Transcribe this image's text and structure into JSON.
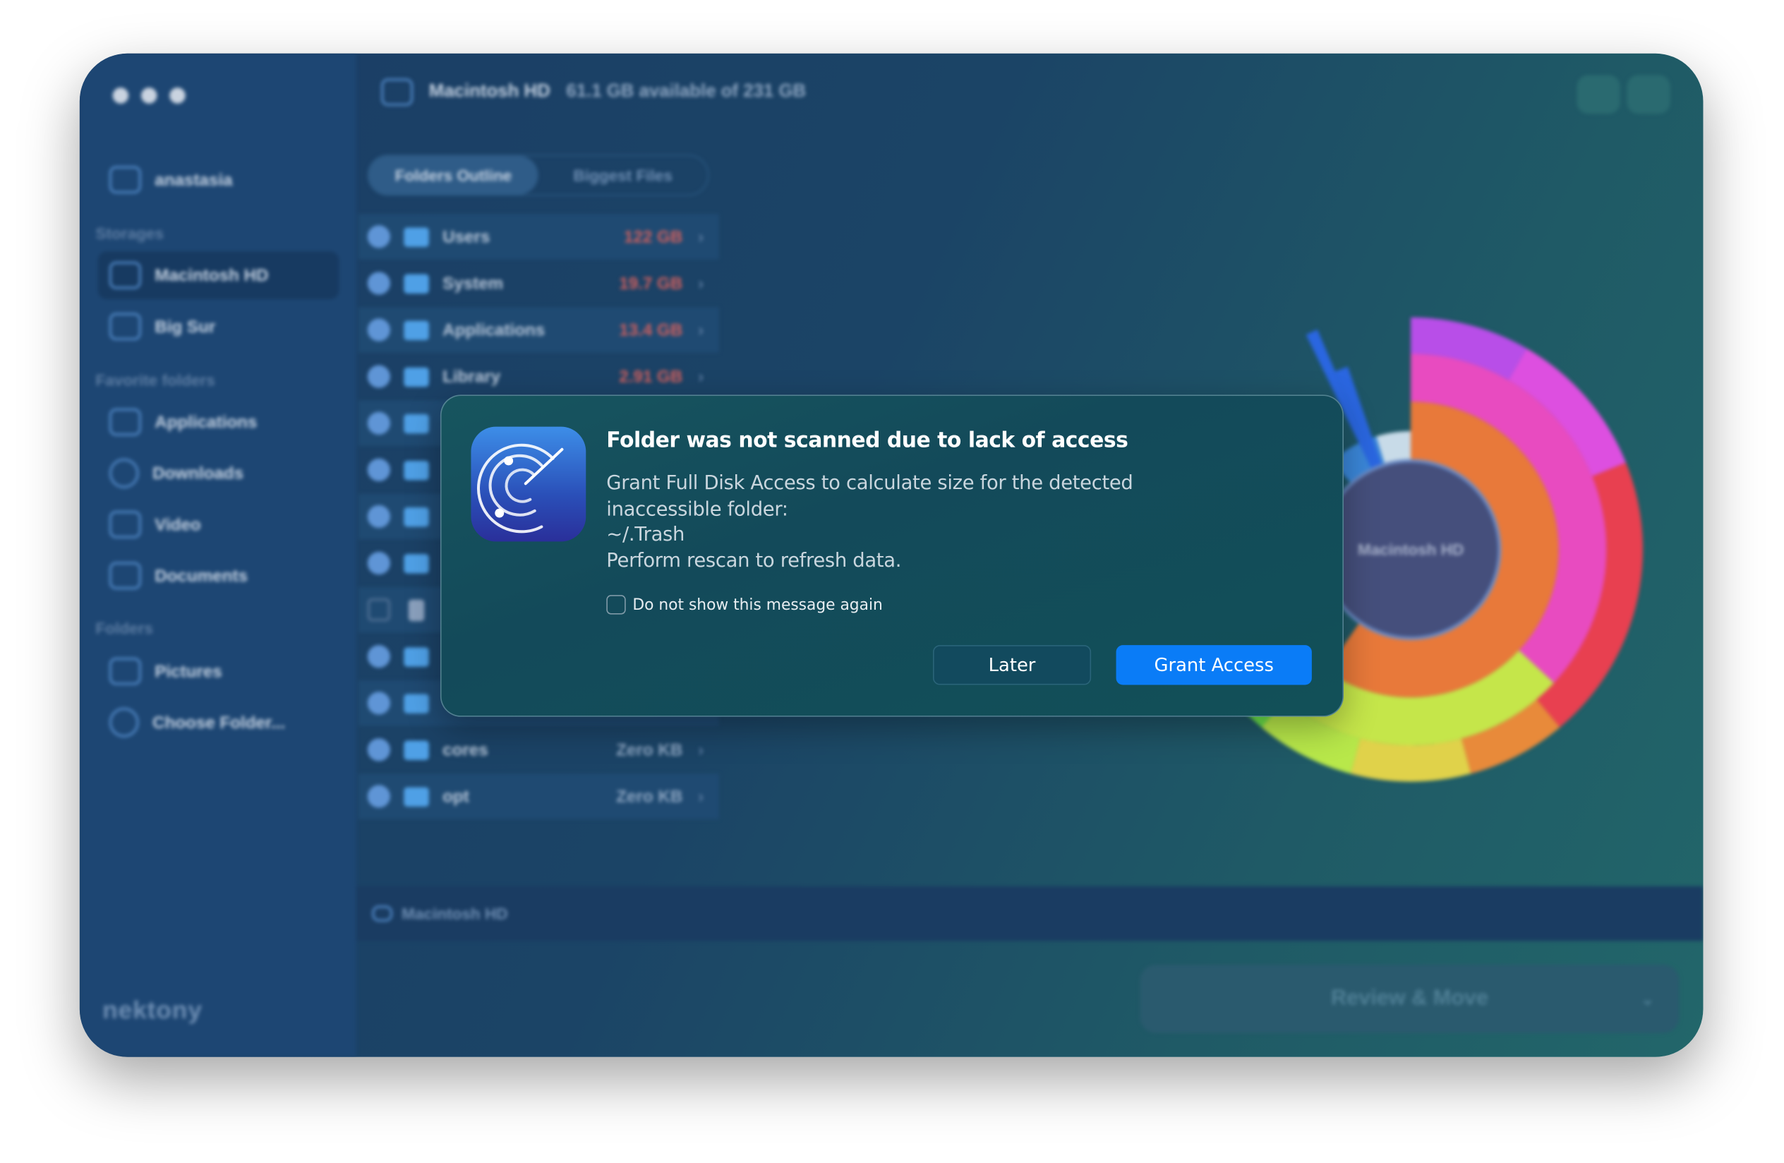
{
  "window": {
    "traffic_lights": [
      "close",
      "minimize",
      "zoom"
    ]
  },
  "sidebar": {
    "user": {
      "label": "anastasia",
      "icon": "home-icon"
    },
    "storages_title": "Storages",
    "storages": [
      {
        "label": "Macintosh HD",
        "selected": true
      },
      {
        "label": "Big Sur"
      }
    ],
    "favorites_title": "Favorite folders",
    "favorites": [
      {
        "label": "Applications",
        "icon": "applications-icon"
      },
      {
        "label": "Downloads",
        "icon": "download-icon"
      },
      {
        "label": "Video",
        "icon": "folder-icon"
      },
      {
        "label": "Documents",
        "icon": "document-icon"
      }
    ],
    "folders_title": "Folders",
    "folders": [
      {
        "label": "Pictures",
        "icon": "camera-icon"
      },
      {
        "label": "Choose Folder...",
        "icon": "plus-circle-icon"
      }
    ],
    "brand": "nektony"
  },
  "header": {
    "disk": "Macintosh HD",
    "availability": "61.1 GB available of 231 GB"
  },
  "tabs": [
    {
      "label": "Folders Outline",
      "active": true
    },
    {
      "label": "Biggest Files",
      "active": false
    }
  ],
  "folders": [
    {
      "name": "Users",
      "size": "122 GB"
    },
    {
      "name": "System",
      "size": "19.7 GB"
    },
    {
      "name": "Applications",
      "size": "13.4 GB"
    },
    {
      "name": "Library",
      "size": "2.91 GB"
    },
    {
      "name": "cores",
      "size": "Zero KB"
    },
    {
      "name": "opt",
      "size": "Zero KB"
    }
  ],
  "chart_center_label": "Macintosh HD",
  "path_bar": "Macintosh HD",
  "review_button": "Review & Move",
  "dialog": {
    "title": "Folder was not scanned due to lack of access",
    "body_lines": [
      "Grant Full Disk Access to calculate size for the detected",
      "inaccessible folder:",
      "~/.Trash",
      "Perform rescan to refresh data."
    ],
    "checkbox_label": "Do not show this message again",
    "checkbox_checked": false,
    "later": "Later",
    "grant": "Grant Access",
    "accent": "#0a7cf7"
  }
}
